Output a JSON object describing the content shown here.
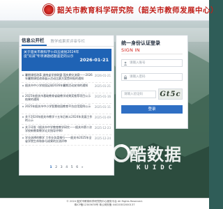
{
  "header": {
    "title": "韶关市教育科学研究院（韶关市教师发展中心）"
  },
  "news_panel": {
    "tab_active": "信息公开栏",
    "tab_other": "教学成果奖评审专栏",
    "featured": {
      "title": "关于韶关市教科学十四五规划2024年度\"双减\"专项课题结题鉴定的公示",
      "date": "2026-01-21"
    },
    "items": [
      {
        "text": "暑期课程改革 湖南省学校联盟 国庆期交流赛——2026年暑期课程改革展示活动比赛方案暨申报的通知",
        "date": "2026-01-21"
      },
      {
        "text": "韶关市中小学校园足球2026年暑期活动安排的通知",
        "date": "2025-01-21"
      },
      {
        "text": "2025年韶关市基础教育省级教学成果奖推荐项目公示结果的通知",
        "date": "2025-01-16"
      },
      {
        "text": "2025年韶关市中小学智慧校园教育平台应用案例公示",
        "date": "2025-01-11"
      },
      {
        "text": "关于2024年韶关市教学十五年后新义2024年发展工作的公示",
        "date": "2025-01-09"
      },
      {
        "text": "关于印发《韶关市中学教育教学研究——韶关市第二次学校新教育教学论文指导评审》",
        "date": "2025-12-23"
      },
      {
        "text": "学业选择的教学 工作业务类推行——韶关市2025年全省学院生命和参与成果的交流评审",
        "date": "2025-12-24"
      }
    ],
    "pagination": [
      "1",
      "2",
      "3",
      "4",
      "5",
      "6",
      "»"
    ]
  },
  "login_panel": {
    "title": "统一身份认证登录",
    "subtitle": "SIGN IN",
    "username_placeholder": "请输入账号",
    "password_placeholder": "请输入密码",
    "captcha_placeholder": "请输入验证码",
    "captcha_text": "Gt5c",
    "submit_label": "登录"
  },
  "watermark": {
    "main": "酷数据",
    "sub": "KUIDC"
  },
  "footer": {
    "line1": "© 2024 韶关市教育科学研究院中心服务平台 All Rights Reserved.",
    "line2": "粤ICP备12345678号   粤公网安备 44020302000137"
  },
  "colors": {
    "brand_red": "#c1201a",
    "primary_blue": "#1f63b5",
    "button_blue": "#2f6fc4"
  }
}
